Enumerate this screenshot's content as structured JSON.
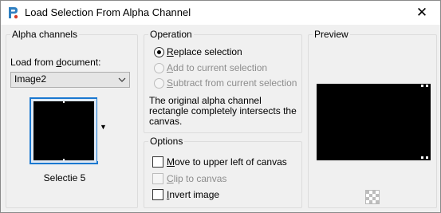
{
  "window": {
    "title": "Load Selection From Alpha Channel",
    "close_glyph": "✕",
    "app_icon": "paintshop-pro-icon"
  },
  "alpha_channels": {
    "group_title": "Alpha channels",
    "load_from_label_pre": "Load from ",
    "load_from_label_underlined": "d",
    "load_from_label_post": "ocument:",
    "document_selected": "Image2",
    "dropdown_glyph": "⌄",
    "thumbnail_caption": "Selectie 5",
    "thumb_dropdown_glyph": "▼"
  },
  "operation": {
    "group_title": "Operation",
    "options": [
      {
        "underlined": "R",
        "rest": "eplace selection",
        "checked": true,
        "enabled": true
      },
      {
        "underlined": "A",
        "rest": "dd to current selection",
        "checked": false,
        "enabled": false
      },
      {
        "underlined": "S",
        "rest": "ubtract from current selection",
        "checked": false,
        "enabled": false
      }
    ],
    "description": "The original alpha channel rectangle completely intersects the canvas."
  },
  "options": {
    "group_title": "Options",
    "items": [
      {
        "underlined": "M",
        "rest": "ove to upper left of canvas",
        "checked": false,
        "enabled": true
      },
      {
        "underlined": "C",
        "rest": "lip to canvas",
        "checked": false,
        "enabled": false
      },
      {
        "underlined": "I",
        "rest": "nvert image",
        "checked": false,
        "enabled": true
      }
    ]
  },
  "preview": {
    "group_title": "Preview",
    "background": "#000000",
    "zoom_icon": "checkerboard-icon"
  },
  "colors": {
    "accent": "#1a78d0",
    "group_border": "#dcdcdc",
    "disabled_text": "#8d8d8d"
  }
}
